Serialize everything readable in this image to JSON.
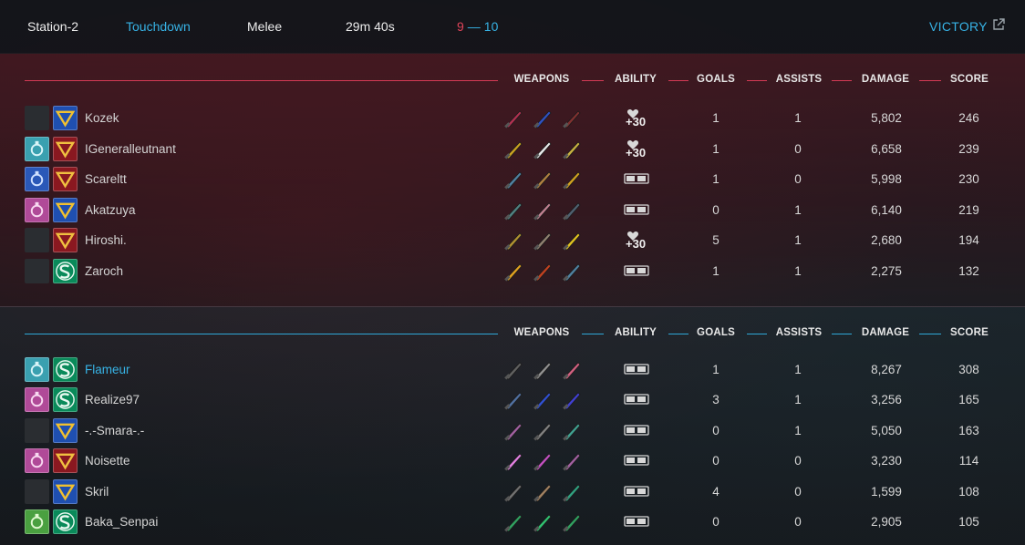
{
  "header": {
    "map": "Station-2",
    "mode": "Touchdown",
    "type": "Melee",
    "duration": "29m 40s",
    "score_red": "9",
    "score_sep": "—",
    "score_blue": "10",
    "result": "VICTORY"
  },
  "columns": {
    "weapons": "WEAPONS",
    "ability": "ABILITY",
    "goals": "GOALS",
    "assists": "ASSISTS",
    "damage": "DAMAGE",
    "score": "SCORE"
  },
  "colors": {
    "red_team": "#d43a55",
    "blue_team": "#2fa8d8",
    "accent": "#37b3e6"
  },
  "teams": [
    {
      "name": "red",
      "players": [
        {
          "name": "Kozek",
          "slot1": "empty",
          "slot2": "gold-emblem",
          "ability": "heal-30",
          "ability_label": "+30",
          "goals": "1",
          "assists": "1",
          "damage": "5,802",
          "score": "246"
        },
        {
          "name": "IGeneralleutnant",
          "slot1": "teal-chip",
          "slot2": "crimson-emblem",
          "ability": "heal-30",
          "ability_label": "+30",
          "goals": "1",
          "assists": "0",
          "damage": "6,658",
          "score": "239"
        },
        {
          "name": "Scareltt",
          "slot1": "blue-chip",
          "slot2": "crimson-emblem",
          "ability": "hp-sp",
          "ability_label": "",
          "goals": "1",
          "assists": "0",
          "damage": "5,998",
          "score": "230"
        },
        {
          "name": "Akatzuya",
          "slot1": "pink-chip",
          "slot2": "blue-emblem",
          "ability": "hp-sp",
          "ability_label": "",
          "goals": "0",
          "assists": "1",
          "damage": "6,140",
          "score": "219"
        },
        {
          "name": "Hiroshi.",
          "slot1": "empty",
          "slot2": "crimson-emblem",
          "ability": "heal-30",
          "ability_label": "+30",
          "goals": "5",
          "assists": "1",
          "damage": "2,680",
          "score": "194"
        },
        {
          "name": "Zaroch",
          "slot1": "empty",
          "slot2": "green-emblem",
          "ability": "hp-sp",
          "ability_label": "",
          "goals": "1",
          "assists": "1",
          "damage": "2,275",
          "score": "132"
        }
      ]
    },
    {
      "name": "blue",
      "players": [
        {
          "name": "Flameur",
          "slot1": "teal-chip",
          "slot2": "green-emblem",
          "ability": "hp-sp",
          "ability_label": "",
          "goals": "1",
          "assists": "1",
          "damage": "8,267",
          "score": "308",
          "highlight": true
        },
        {
          "name": "Realize97",
          "slot1": "pink-chip",
          "slot2": "green-emblem",
          "ability": "hp-sp",
          "ability_label": "",
          "goals": "3",
          "assists": "1",
          "damage": "3,256",
          "score": "165"
        },
        {
          "name": "-.-Smara-.-",
          "slot1": "empty",
          "slot2": "blue-emblem",
          "ability": "hp-sp",
          "ability_label": "",
          "goals": "0",
          "assists": "1",
          "damage": "5,050",
          "score": "163"
        },
        {
          "name": "Noisette",
          "slot1": "pink-chip",
          "slot2": "crimson-emblem",
          "ability": "hp-sp",
          "ability_label": "",
          "goals": "0",
          "assists": "0",
          "damage": "3,230",
          "score": "114"
        },
        {
          "name": "Skril",
          "slot1": "empty",
          "slot2": "blue-emblem",
          "ability": "hp-sp",
          "ability_label": "",
          "goals": "4",
          "assists": "0",
          "damage": "1,599",
          "score": "108"
        },
        {
          "name": "Baka_Senpai",
          "slot1": "green-chip",
          "slot2": "green-emblem",
          "ability": "hp-sp",
          "ability_label": "",
          "goals": "0",
          "assists": "0",
          "damage": "2,905",
          "score": "105"
        }
      ]
    }
  ],
  "weapon_colors": [
    [
      "#b03050",
      "#3050c0",
      "#803030"
    ],
    [
      "#c8a020",
      "#e8e8e8",
      "#c8b040"
    ],
    [
      "#5080a0",
      "#b08040",
      "#d0a020"
    ],
    [
      "#508080",
      "#c08090",
      "#506070"
    ],
    [
      "#b09030",
      "#908070",
      "#e0c020"
    ],
    [
      "#e0a020",
      "#c04020",
      "#5080a0"
    ],
    [
      "#606060",
      "#909090",
      "#d06080"
    ],
    [
      "#5070a0",
      "#3050d0",
      "#4040d0"
    ],
    [
      "#a060a0",
      "#808080",
      "#40a090"
    ],
    [
      "#e080e0",
      "#c050c0",
      "#a060a0"
    ],
    [
      "#707070",
      "#a08060",
      "#30a080"
    ],
    [
      "#30a060",
      "#30c070",
      "#30a060"
    ]
  ]
}
